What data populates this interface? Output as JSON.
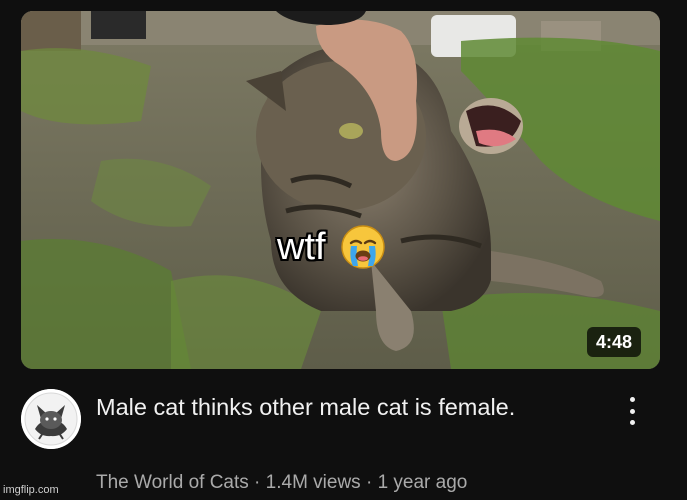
{
  "video": {
    "thumbnail_caption": "wtf",
    "caption_emoji_icon": "loudly-crying-face-icon",
    "duration": "4:48",
    "title": "Male cat thinks other male cat is female.",
    "channel": "The World of Cats",
    "views": "1.4M views",
    "age": "1 year ago",
    "separator": "·",
    "more_icon": "vertical-ellipsis-icon"
  },
  "watermark": "imgflip.com",
  "colors": {
    "background": "#0f0f0f",
    "title_text": "#f1f1f1",
    "meta_text": "#aaaaaa",
    "duration_badge": "#000000"
  }
}
